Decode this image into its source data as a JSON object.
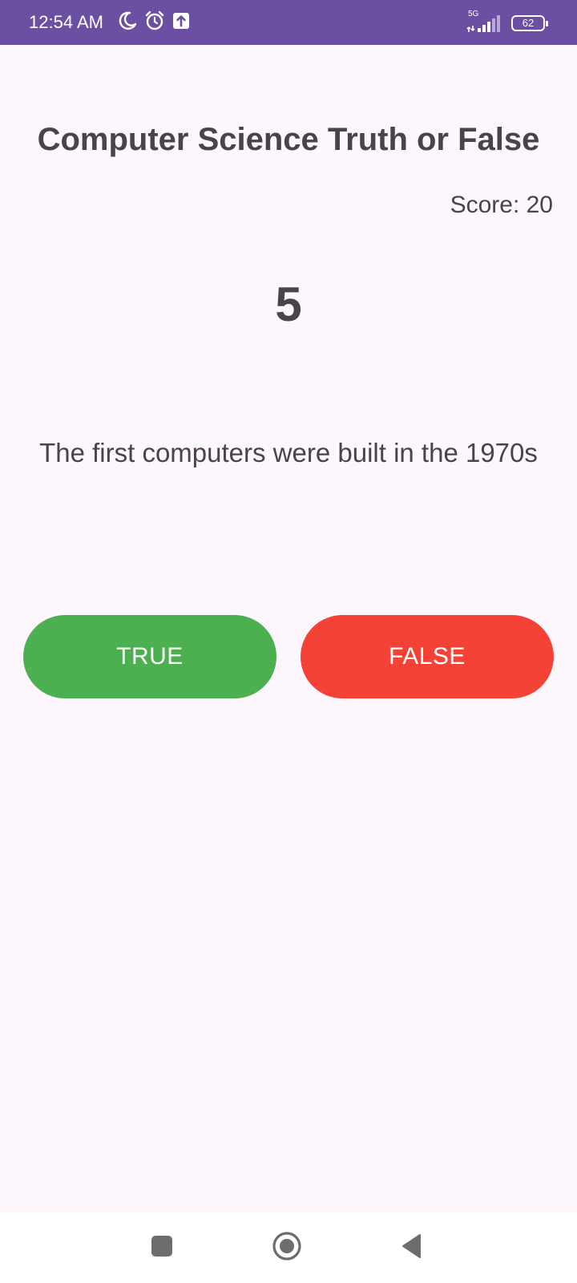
{
  "status_bar": {
    "time": "12:54 AM",
    "network": "5G",
    "battery": "62",
    "icons": [
      "moon-icon",
      "alarm-icon",
      "upload-icon",
      "signal-icon",
      "battery-icon"
    ],
    "background_color": "#6a4fa3"
  },
  "quiz": {
    "title": "Computer Science Truth or False",
    "score": "Score: 20",
    "timer": "5",
    "question": "The first computers were built in the 1970s"
  },
  "buttons": {
    "true_label": "TRUE",
    "true_color": "#4caf50",
    "false_label": "FALSE",
    "false_color": "#f44336"
  },
  "nav_bar": {
    "icons": [
      "recents-icon",
      "home-icon",
      "back-icon"
    ]
  }
}
